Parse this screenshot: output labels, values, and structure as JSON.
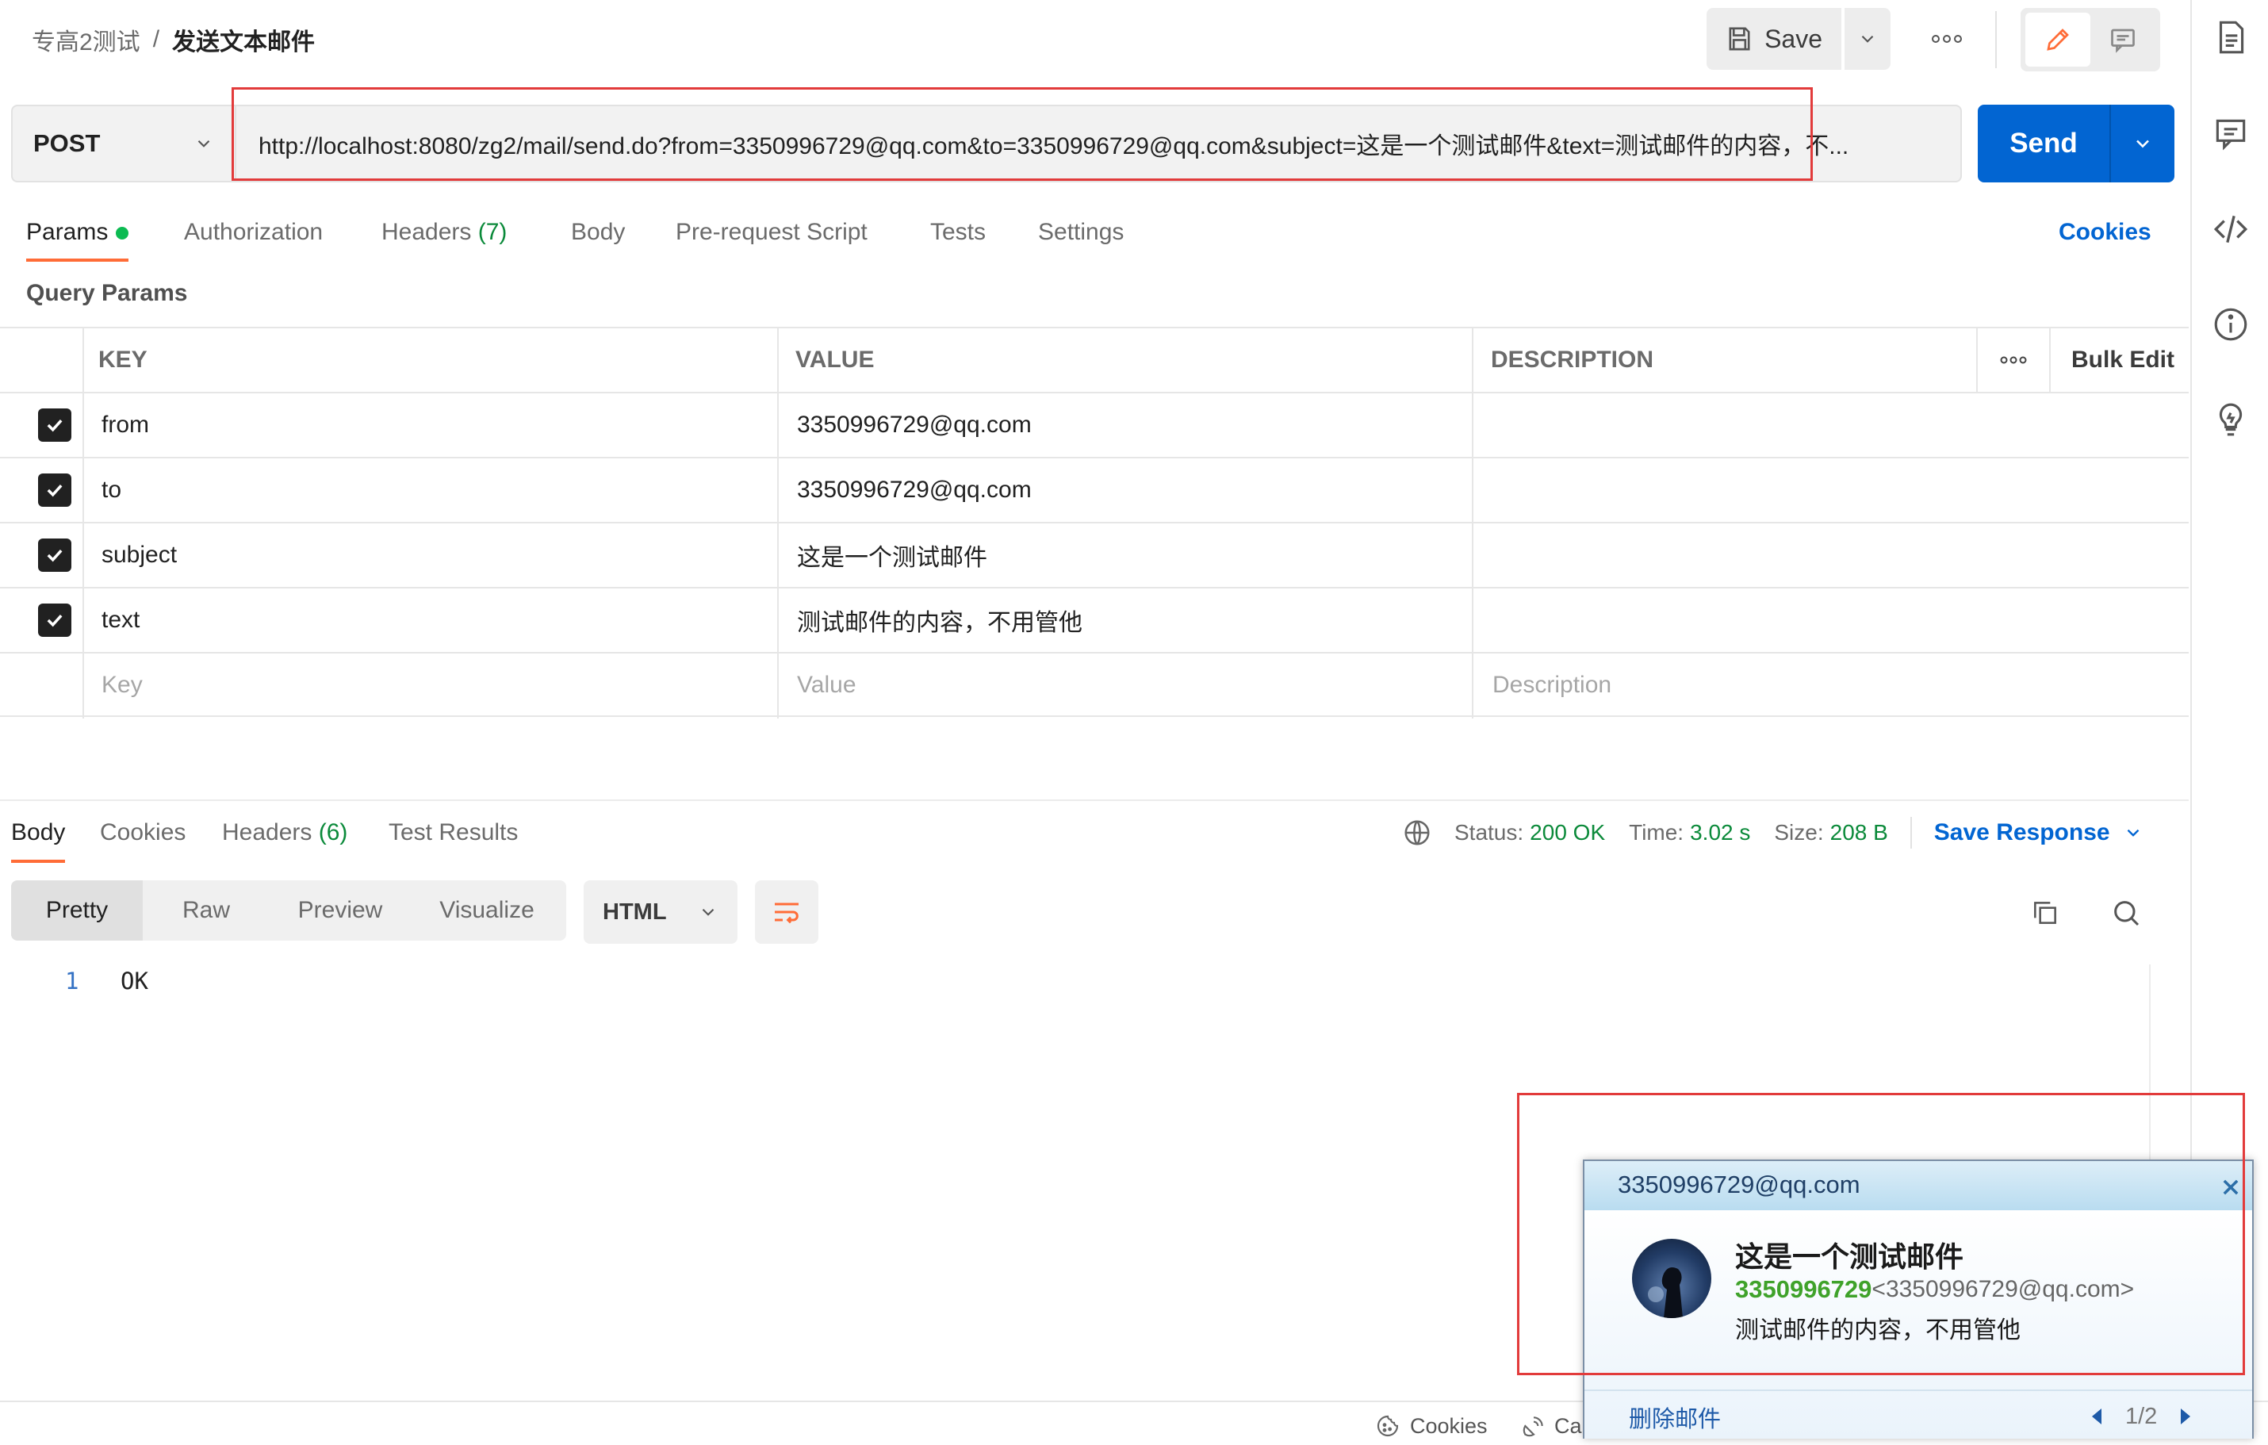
{
  "breadcrumb": {
    "parent": "专高2测试",
    "separator": "/",
    "current": "发送文本邮件"
  },
  "toolbar": {
    "save_label": "Save"
  },
  "request": {
    "method": "POST",
    "url": "http://localhost:8080/zg2/mail/send.do?from=3350996729@qq.com&to=3350996729@qq.com&subject=这是一个测试邮件&text=测试邮件的内容，不...",
    "send_label": "Send"
  },
  "tabs": {
    "params": "Params",
    "authorization": "Authorization",
    "headers": "Headers",
    "headers_count": "(7)",
    "body": "Body",
    "prerequest": "Pre-request Script",
    "tests": "Tests",
    "settings": "Settings",
    "cookies": "Cookies"
  },
  "query_params": {
    "label": "Query Params",
    "headers": {
      "key": "KEY",
      "value": "VALUE",
      "description": "DESCRIPTION",
      "bulk_edit": "Bulk Edit"
    },
    "rows": [
      {
        "key": "from",
        "value": "3350996729@qq.com",
        "checked": true
      },
      {
        "key": "to",
        "value": "3350996729@qq.com",
        "checked": true
      },
      {
        "key": "subject",
        "value": "这是一个测试邮件",
        "checked": true
      },
      {
        "key": "text",
        "value": "测试邮件的内容，不用管他",
        "checked": true
      }
    ],
    "placeholders": {
      "key": "Key",
      "value": "Value",
      "description": "Description"
    }
  },
  "response": {
    "tabs": {
      "body": "Body",
      "cookies": "Cookies",
      "headers": "Headers",
      "headers_count": "(6)",
      "test_results": "Test Results"
    },
    "status_label": "Status:",
    "status_value": "200 OK",
    "time_label": "Time:",
    "time_value": "3.02 s",
    "size_label": "Size:",
    "size_value": "208 B",
    "save_response": "Save Response",
    "formats": {
      "pretty": "Pretty",
      "raw": "Raw",
      "preview": "Preview",
      "visualize": "Visualize"
    },
    "language": "HTML",
    "line_number": "1",
    "content": "OK"
  },
  "footer": {
    "cookies": "Cookies",
    "truncated": "Ca"
  },
  "notification": {
    "account": "3350996729@qq.com",
    "subject": "这是一个测试邮件",
    "sender_name": "3350996729",
    "sender_email": "<3350996729@qq.com>",
    "preview": "测试邮件的内容，不用管他",
    "delete_label": "删除邮件",
    "pager": "1/2"
  },
  "colors": {
    "accent_orange": "#ff6c37",
    "brand_blue": "#0265d2",
    "success_green": "#0b8a3a",
    "highlight_red": "#e23b3b"
  }
}
